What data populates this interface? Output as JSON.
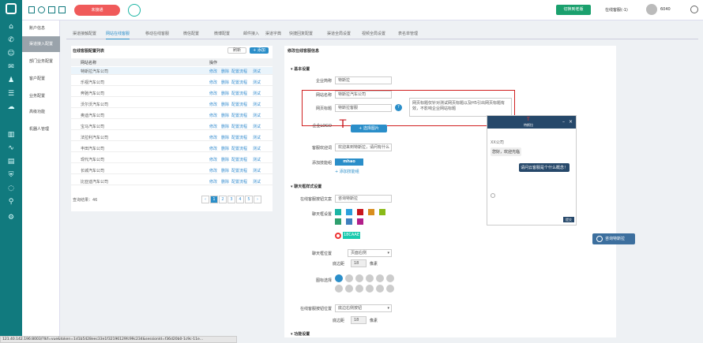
{
  "topbar": {
    "red_button": "未接通",
    "green_button": "切换到老版",
    "online_status": "在线客服(-1)",
    "user_id": "6040"
  },
  "sidebar_icons": [
    "home-icon",
    "phone-icon",
    "chat-icon",
    "mail-icon",
    "users-icon",
    "task-icon",
    "cloud-icon",
    "chart-icon",
    "pulse-icon",
    "doc-icon",
    "shield-icon",
    "bubble-icon",
    "link-icon",
    "gear-icon"
  ],
  "subnav": {
    "items": [
      "账户信息",
      "渠道接入配置",
      "部门业务配置",
      "客户配置",
      "业务配置",
      "高级功能",
      "机器人管理"
    ],
    "active_index": 1
  },
  "tabs": {
    "items": [
      "渠道接触配置",
      "网站在线客服",
      "移动在线客服",
      "微信配置",
      "微博配置",
      "邮件接入",
      "渠道字典",
      "快捷回复配置",
      "渠道全局设置",
      "视频全局设置",
      "表名单管理"
    ],
    "active_index": 1
  },
  "left": {
    "title": "在线客服配置列表",
    "refresh": "刷新",
    "add": "+ 添加",
    "col_name": "网站名称",
    "col_ops": "操作",
    "rows": [
      "特斯拉汽车公司",
      "乐视汽车公司",
      "奔驰汽车公司",
      "沃尔沃汽车公司",
      "奥迪汽车公司",
      "宝马汽车公司",
      "法拉利汽车公司",
      "丰田汽车公司",
      "现代汽车公司",
      "长城汽车公司",
      "比亚迪汽车公司"
    ],
    "ops": [
      "修改",
      "删除",
      "配置流程",
      "测试"
    ],
    "total": "查询结果：46",
    "pages": [
      "‹",
      "1",
      "2",
      "3",
      "4",
      "5",
      "›"
    ]
  },
  "right": {
    "title": "修改在线客服信息",
    "basic": "基本设置",
    "company_label": "企业简称",
    "company_value": "特斯拉",
    "website_label": "网站名称",
    "website_value": "特斯拉汽车公司",
    "sitetitle_label": "网页标题",
    "sitetitle_value": "特斯拉客服",
    "tooltip": "网页标题仅针对测试网页标题以及H5引出网页标题有效，不影响企业网站标题",
    "logo_label": "企业LOGO",
    "logo_btn": "+ 选择图片",
    "welcome_label": "客服欢迎词",
    "welcome_value": "欢迎来到特斯拉，请问有什么",
    "skill_label": "添加技能组",
    "skill_tag": "mhao",
    "skill_add": "+ 添加技能组",
    "chat_style": "聊天框样式设置",
    "btn_text_label": "在线客服按钮文案",
    "btn_text_value": "咨询特斯拉",
    "color_label": "聊天框设置",
    "colors": [
      "#1bb5a4",
      "#2b9fdc",
      "#c8151c",
      "#d88e1f",
      "#8aba18",
      "#2f9f6e",
      "#3f7fbd",
      "#b21f8a"
    ],
    "custom_color": "18CAAE",
    "pos_label": "聊天框位置",
    "pos_value": "页面右侧",
    "bottom_label": "底边距",
    "bottom_value": "18",
    "px": "像素",
    "icon_label": "图标选择",
    "btnpos_label": "在线客服按钮位置",
    "btnpos_value": "底边右侧按钮",
    "bottom2_value": "18",
    "func": "功能设置"
  },
  "preview": {
    "title": "特斯拉",
    "company": "XX公司",
    "greeting": "您好，欢迎光临",
    "user_msg": "请问云客服是个什么概念！",
    "submit": "提交",
    "float_btn": "咨询特斯拉"
  },
  "statusbar": "121.40.142.196:8003/?lkf=vue&token=1d1b5428eec33e1f32196129fc99c234&sessionId=f36d20b0-1c9c-11e..."
}
